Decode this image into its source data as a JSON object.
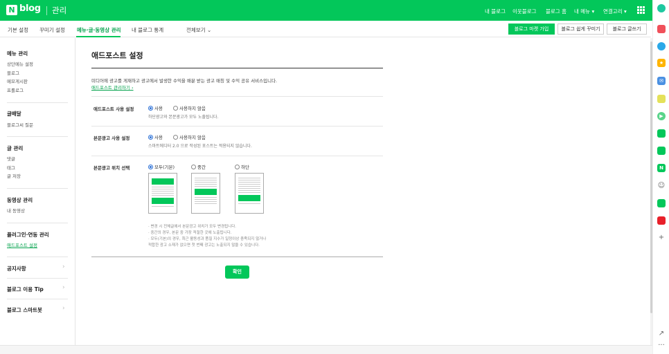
{
  "topbar": {
    "logo_mark": "N",
    "logo_text": "blog",
    "title": "관리",
    "links": [
      "내 블로그",
      "이웃블로그",
      "블로그 홈",
      "내 메뉴 ▾",
      "연결고리 ▾"
    ],
    "grid_icon": "grid-icon"
  },
  "subbar": {
    "tabs": [
      "기본 설정",
      "꾸미기 설정",
      "메뉴·글·동영상 관리",
      "내 블로그 통계",
      "전체보기"
    ],
    "active_tab": 2,
    "buttons": [
      "블로그 마켓 가입",
      "블로그 쉽게 꾸미기",
      "블로그 글쓰기"
    ]
  },
  "sidebar": {
    "sections": [
      {
        "title": "메뉴 관리",
        "items": [
          "상단메뉴 설정",
          "블로그",
          "메모게시판",
          "프롤로그"
        ]
      },
      {
        "title": "글배달",
        "items": [
          "블로그씨 질문"
        ]
      },
      {
        "title": "글 관리",
        "items": [
          "댓글",
          "태그",
          "글 저장"
        ]
      },
      {
        "title": "동영상 관리",
        "items": [
          "내 동영상"
        ]
      },
      {
        "title": "플러그인·연동 관리",
        "items": [
          "애드포스트 설정"
        ]
      }
    ],
    "links": [
      "공지사항",
      "블로그 이용 Tip",
      "블로그 스마트봇"
    ]
  },
  "main": {
    "title": "애드포스트 설정",
    "description": "미디어에 광고를 게재하고 광고에서 발생한 수익을 배분 받는 광고 매칭 및 수익 공유 서비스입니다.",
    "manage_link": "애드포스트 관리하기 ›",
    "rows": [
      {
        "label": "애드포스트 사용 설정",
        "options": [
          "사용",
          "사용하지 않음"
        ],
        "helper": "하단광고와 본문광고가 모두 노출됩니다."
      },
      {
        "label": "본문광고 사용 설정",
        "options": [
          "사용",
          "사용하지 않음"
        ],
        "helper": "스마트에디터 2.0 으로 작성된 포스트는 적용되지 않습니다."
      },
      {
        "label": "본문광고 위치 선택",
        "options": [
          "모두(기본)",
          "중간",
          "하단"
        ]
      }
    ],
    "notes": [
      "· 변경 시 전체글에서 본문광고 위치가 모두 변경됩니다.",
      "· 중간의 경우, 본문 중 가장 적절한 곳에 노출됩니다.",
      "· 모두(기본)의 경우, 최근 활동성과 품질 지수가 일정이상 충족되지 않거나",
      "  적합한 광고 소재가 없으면 첫 번째 광고는 노출되지 않을 수 있습니다."
    ],
    "confirm": "확인"
  },
  "rail": {
    "icons": [
      "naver-app-icon",
      "pocket-icon",
      "edge-icon",
      "star-icon",
      "mail-icon",
      "memo-icon",
      "play-icon",
      "talk-icon",
      "cafe-icon",
      "naver-n-icon",
      "clova-icon",
      "webtoon-icon",
      "news-icon"
    ],
    "add": "+",
    "external": "↗",
    "more": "···"
  }
}
